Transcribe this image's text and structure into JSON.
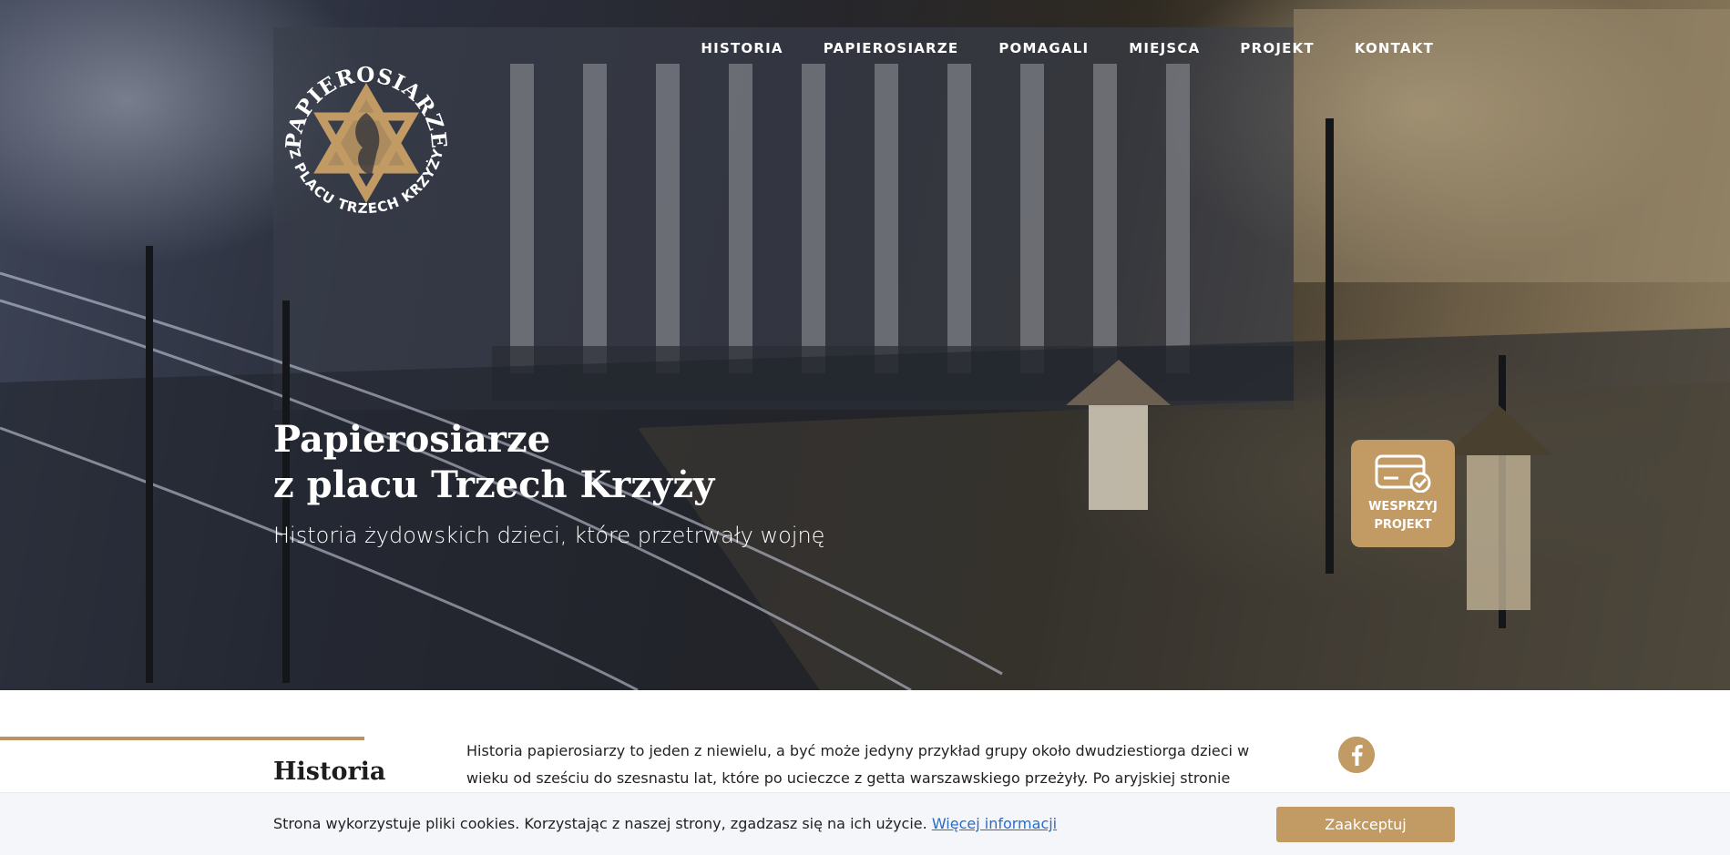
{
  "nav": {
    "items": [
      "HISTORIA",
      "PAPIEROSIARZE",
      "POMAGALI",
      "MIEJSCA",
      "PROJEKT",
      "KONTAKT"
    ]
  },
  "logo": {
    "top_text": "PAPIEROSIARZE",
    "bottom_text": "Z PLACU TRZECH KRZYŻY"
  },
  "hero": {
    "title_line1": "Papierosiarze",
    "title_line2": "z placu Trzech Krzyży",
    "subtitle": "Historia żydowskich dzieci, które przetrwały wojnę"
  },
  "support_button": {
    "label": "WESPRZYJ\nPROJEKT",
    "icon": "credit-card-check-icon"
  },
  "section": {
    "title": "Historia",
    "body": "Historia papierosiarzy to jeden z niewielu, a być może jedyny przykład grupy około dwudziestiorga dzieci w wieku od sześciu do szesnastu lat, które po ucieczce z getta warszawskiego przeżyły. Po aryjskiej stronie"
  },
  "social": {
    "icon": "facebook-icon"
  },
  "cookie": {
    "text": "Strona wykorzystuje pliki cookies. Korzystając z naszej strony, zgadzasz się na ich użycie.",
    "link": "Więcej informacji",
    "button": "Zaakceptuj"
  },
  "colors": {
    "accent": "#c19a64",
    "text_dark": "#1d1d1d",
    "link": "#2a6cc7",
    "cookie_bg": "#f4f6f9"
  }
}
